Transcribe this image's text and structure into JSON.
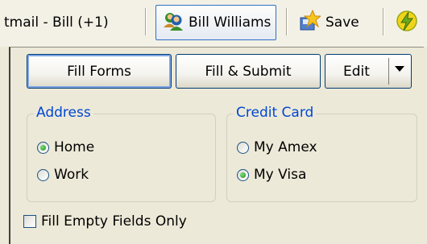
{
  "toolbar": {
    "account_label": "tmail - Bill (+1)",
    "identity_label": "Bill Williams",
    "identity_icon": "identity-icon",
    "save_label": "Save",
    "save_icon": "save-star-icon",
    "bolt_icon": "lightning-icon"
  },
  "actions": {
    "fill_forms": "Fill Forms",
    "fill_submit": "Fill & Submit",
    "edit": "Edit"
  },
  "address": {
    "legend": "Address",
    "options": [
      "Home",
      "Work"
    ],
    "selected": "Home"
  },
  "credit_card": {
    "legend": "Credit Card",
    "options": [
      "My Amex",
      "My Visa"
    ],
    "selected": "My Visa"
  },
  "fill_empty_only": {
    "label": "Fill Empty Fields Only",
    "checked": false
  },
  "colors": {
    "legend_blue": "#0046d5",
    "button_border": "#003c74",
    "focus_ring": "#7fa6e4",
    "panel_bg": "#ece9d8"
  }
}
